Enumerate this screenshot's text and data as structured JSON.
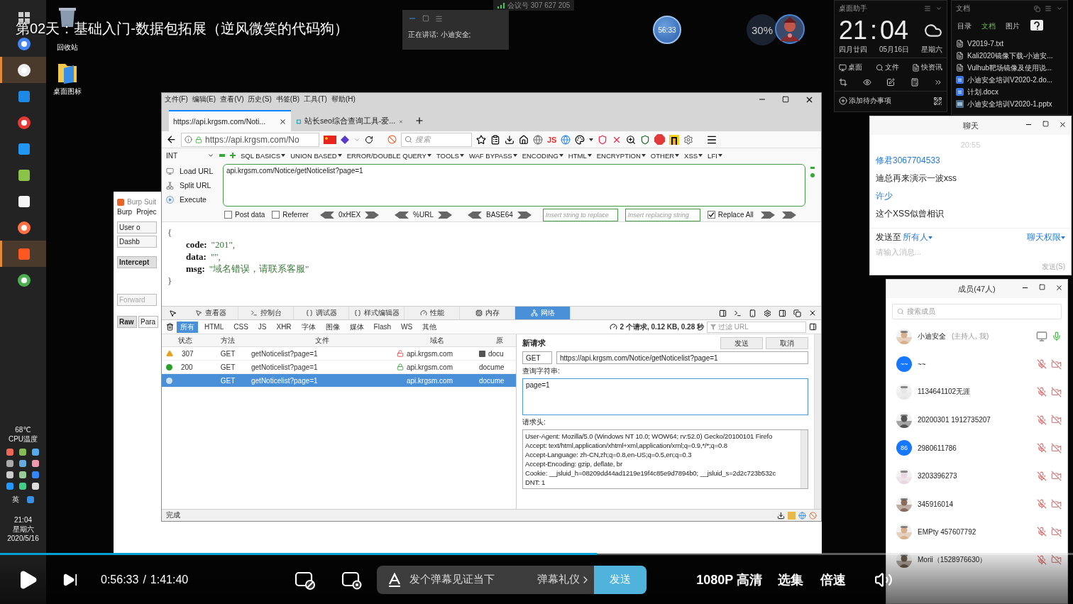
{
  "video_title": "第02天：基础入门-数据包拓展（逆风微笑的代码狗）",
  "desktop_icons": [
    {
      "label": "回收站",
      "kind": "bin"
    },
    {
      "label": "桌面图标",
      "kind": "folder"
    }
  ],
  "meeting_id": "会议号 307 627 205",
  "speaker_panel": {
    "text": "正在讲话: 小迪安全;"
  },
  "timer_badge": "56:33",
  "cpu_widget": {
    "percent": "30%"
  },
  "taskbar": {
    "temperature": "68℃",
    "temperature_label": "CPU温度",
    "ime": "英",
    "time": "21:04",
    "weekday": "星期六",
    "date": "2020/5/16"
  },
  "assistant": {
    "title": "桌面助手",
    "hour": "21",
    "separator": ":",
    "minute": "04",
    "lunar": "四月廿四",
    "date": "05月16日",
    "weekday": "星期六",
    "links": [
      "桌面",
      "文件",
      "快资讯"
    ],
    "todo": "添加待办事项"
  },
  "docs": {
    "title": "文档",
    "tabs": [
      {
        "label": "目录",
        "selected": false
      },
      {
        "label": "文档",
        "selected": true
      },
      {
        "label": "图片",
        "selected": false
      }
    ],
    "files": [
      {
        "name": "V2019-7.txt",
        "kind": "text"
      },
      {
        "name": "Kali2020镜像下载-小迪安...",
        "kind": "text"
      },
      {
        "name": "Vulhub靶场镜像及使用说...",
        "kind": "text"
      },
      {
        "name": "小迪安全培训V2020-2.do...",
        "kind": "word"
      },
      {
        "name": "计划.docx",
        "kind": "word"
      },
      {
        "name": "小迪安全培训V2020-1.pptx",
        "kind": "slides"
      }
    ]
  },
  "burp": {
    "title": "Burp Suit",
    "menu": [
      "Burp",
      "Projec"
    ],
    "buttons": [
      "User o",
      "Dashb"
    ],
    "tabs": [
      {
        "label": "Intercept",
        "selected": true
      }
    ],
    "forward": {
      "label": "Forward",
      "disabled": true
    },
    "subtabs": [
      {
        "label": "Raw",
        "selected": true
      },
      {
        "label": "Para",
        "selected": false
      }
    ]
  },
  "browser": {
    "menu": [
      "文件(F)",
      "编辑(E)",
      "查看(V)",
      "历史(S)",
      "书签(B)",
      "工具(T)",
      "帮助(H)"
    ],
    "tabs": [
      {
        "title": "https://api.krgsm.com/Noti...",
        "selected": true
      },
      {
        "title": "站长seo综合查询工具-爱...",
        "selected": false
      }
    ],
    "address": "https://api.krgsm.com/No",
    "search_placeholder": "搜索",
    "toolbar_text": "JS",
    "hackbar": {
      "select": "INT",
      "menus": [
        "SQL BASICS",
        "UNION BASED",
        "ERROR/DOUBLE QUERY",
        "TOOLS",
        "WAF BYPASS",
        "ENCODING",
        "HTML",
        "ENCRYPTION",
        "OTHER",
        "XSS",
        "LFI"
      ],
      "actions": [
        "Load URL",
        "Split URL",
        "Execute"
      ],
      "url": "api.krgsm.com/Notice/getNoticelist?page=1",
      "options": [
        {
          "label": "Post data",
          "checked": false
        },
        {
          "label": "Referrer",
          "checked": false
        }
      ],
      "encoders": [
        "0xHEX",
        "%URL",
        "BASE64"
      ],
      "replace_placeholders": [
        "Insert string to replace",
        "Insert replacing string"
      ],
      "replace_all": {
        "label": "Replace All",
        "checked": true
      }
    },
    "page": {
      "open": "{",
      "fields": [
        {
          "key": "code:",
          "value": "\"201\","
        },
        {
          "key": "data:",
          "value": "\"\","
        },
        {
          "key": "msg:",
          "value": "\"域名错误，请联系客服\""
        }
      ],
      "close": "}"
    },
    "devtools": {
      "tabs": [
        {
          "label": "查看器",
          "selected": false
        },
        {
          "label": "控制台",
          "selected": false
        },
        {
          "label": "调试器",
          "selected": false
        },
        {
          "label": "样式编辑器",
          "selected": false
        },
        {
          "label": "性能",
          "selected": false
        },
        {
          "label": "内存",
          "selected": false
        },
        {
          "label": "网络",
          "selected": true
        }
      ],
      "filters": [
        {
          "label": "所有",
          "selected": true
        },
        {
          "label": "HTML",
          "selected": false
        },
        {
          "label": "CSS",
          "selected": false
        },
        {
          "label": "JS",
          "selected": false
        },
        {
          "label": "XHR",
          "selected": false
        },
        {
          "label": "字体",
          "selected": false
        },
        {
          "label": "图像",
          "selected": false
        },
        {
          "label": "媒体",
          "selected": false
        },
        {
          "label": "Flash",
          "selected": false
        },
        {
          "label": "WS",
          "selected": false
        },
        {
          "label": "其他",
          "selected": false
        }
      ],
      "summary": "2 个请求, 0.12 KB, 0.28 秒",
      "filter_placeholder": "过滤 URL"
    },
    "network": {
      "columns": [
        "状态",
        "方法",
        "文件",
        "域名",
        "原"
      ],
      "rows": [
        {
          "status": "307",
          "status_icon": {
            "kind": "warning"
          },
          "method": "GET",
          "file": "getNoticelist?page=1",
          "domain": "api.krgsm.com",
          "domain_icon": {
            "kind": "unlocked"
          },
          "cause": "docu",
          "selected": false
        },
        {
          "status": "200",
          "status_icon": {
            "kind": "dot",
            "color": "#2aa02a"
          },
          "method": "GET",
          "file": "getNoticelist?page=1",
          "domain": "api.krgsm.com",
          "domain_icon": {
            "kind": "lock"
          },
          "cause": "docume",
          "selected": false
        },
        {
          "status_icon": {
            "kind": "dot",
            "color": "#cfe0f5"
          },
          "method": "GET",
          "file": "getNoticelist?page=1",
          "domain": "api.krgsm.com",
          "cause": "docume",
          "selected": true
        }
      ]
    },
    "request": {
      "title": "新请求",
      "buttons": [
        "发送",
        "取消"
      ],
      "method": "GET",
      "url": "https://api.krgsm.com/Notice/getNoticelist?page=1",
      "query_label": "查询字符串:",
      "query": "page=1",
      "headers_label": "请求头:",
      "headers": [
        "User-Agent: Mozilla/5.0 (Windows NT 10.0; WOW64; rv:52.0) Gecko/20100101 Firefo",
        "Accept: text/html,application/xhtml+xml,application/xml;q=0.9,*/*;q=0.8",
        "Accept-Language: zh-CN,zh;q=0.8,en-US;q=0.5,en;q=0.3",
        "Accept-Encoding: gzip, deflate, br",
        "Cookie: __jsluid_h=08209dd44ad1219e19f4c85e9d7894b0; __jsluid_s=2d2c723b532c",
        "DNT: 1"
      ]
    },
    "status": "完成"
  },
  "chat": {
    "title": "聊天",
    "time": "20:55",
    "messages": [
      {
        "sender": "修君3067704533",
        "text": "迪总再来演示一波xss"
      },
      {
        "sender": "许少",
        "text": "这个XSS似曾相识"
      }
    ],
    "send_to_label": "发送至",
    "send_to": "所有人",
    "permissions": "聊天权限",
    "placeholder": "请输入消息...",
    "send_button": "发送(S)"
  },
  "members": {
    "title": "成员(47人)",
    "search_placeholder": "搜索成员",
    "list": [
      {
        "name": "小迪安全",
        "role": "(主持人, 我)",
        "sharing": true,
        "muted": false,
        "camera_off": false
      },
      {
        "name": "~~",
        "avatar": {
          "kind": "text",
          "text": "~~"
        },
        "sharing": false,
        "muted": true,
        "camera_off": true
      },
      {
        "name": "1134641102无涯",
        "sharing": false,
        "muted": true,
        "camera_off": true
      },
      {
        "name": "20200301 1912735207",
        "sharing": false,
        "muted": true,
        "camera_off": true
      },
      {
        "name": "2980611786",
        "avatar": {
          "kind": "text",
          "text": "86"
        },
        "sharing": false,
        "muted": true,
        "camera_off": true
      },
      {
        "name": "3203396273",
        "sharing": false,
        "muted": true,
        "camera_off": true
      },
      {
        "name": "345916014",
        "sharing": false,
        "muted": true,
        "camera_off": true
      },
      {
        "name": "EMPty 457607792",
        "sharing": false,
        "muted": true,
        "camera_off": true
      },
      {
        "name": "Morii（1528976630）",
        "sharing": false,
        "muted": true,
        "camera_off": true
      }
    ]
  },
  "player": {
    "level": 0.556,
    "time": "0:56:33",
    "separator": "/",
    "duration": "1:41:40",
    "danmaku_placeholder": "发个弹幕见证当下",
    "etiquette": "弹幕礼仪",
    "send": "发送",
    "quality": "1080P 高清",
    "episodes": "选集",
    "speed": "倍速"
  }
}
